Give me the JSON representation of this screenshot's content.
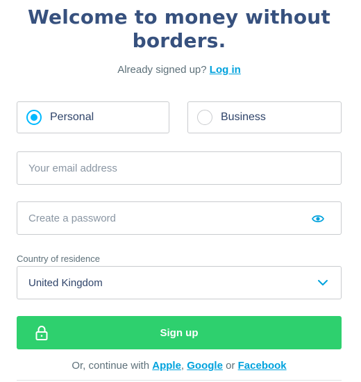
{
  "heading": {
    "line1": "Welcome to money without",
    "line2": "borders."
  },
  "login": {
    "prompt": "Already signed up?",
    "link": "Log in"
  },
  "account_type": {
    "options": [
      {
        "label": "Personal",
        "selected": true
      },
      {
        "label": "Business",
        "selected": false
      }
    ]
  },
  "email": {
    "placeholder": "Your email address",
    "value": ""
  },
  "password": {
    "placeholder": "Create a password",
    "value": "",
    "toggle_icon": "eye-icon"
  },
  "country": {
    "label": "Country of residence",
    "value": "United Kingdom",
    "icon": "chevron-down-icon"
  },
  "signup_button": {
    "label": "Sign up",
    "icon": "lock-icon"
  },
  "continue": {
    "prefix": "Or, continue with",
    "apple": "Apple",
    "sep1": ",",
    "google": "Google",
    "or": "or",
    "facebook": "Facebook"
  },
  "colors": {
    "brand": "#37517e",
    "accent": "#00b9ff",
    "link": "#00a2dd",
    "cta": "#2ed06e"
  }
}
